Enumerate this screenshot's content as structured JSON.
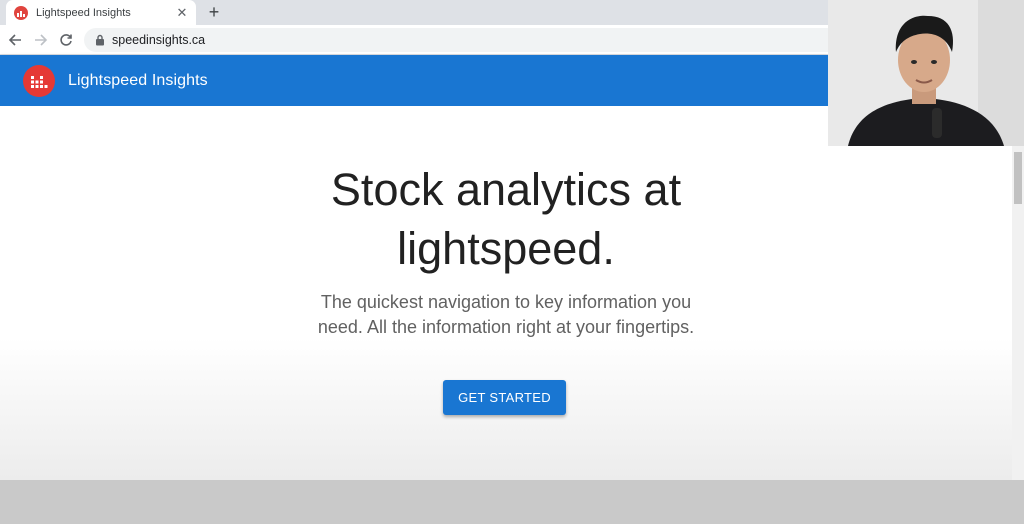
{
  "browser": {
    "tab_title": "Lightspeed Insights",
    "tab_close_glyph": "✕",
    "new_tab_glyph": "+",
    "url": "speedinsights.ca"
  },
  "appbar": {
    "title": "Lightspeed Insights",
    "color": "#1976d2",
    "logo_color": "#e53935"
  },
  "hero": {
    "title_line1": "Stock analytics at",
    "title_line2": "lightspeed.",
    "subtitle_line1": "The quickest navigation to key information you",
    "subtitle_line2": "need. All the information right at your fingertips.",
    "cta_label": "GET STARTED"
  },
  "icons": [
    "favicon-icon",
    "close-icon",
    "plus-icon",
    "back-arrow-icon",
    "forward-arrow-icon",
    "reload-icon",
    "lock-icon",
    "bar-chart-logo-icon"
  ],
  "webcam": {
    "description_icon": "presenter-video-icon"
  }
}
